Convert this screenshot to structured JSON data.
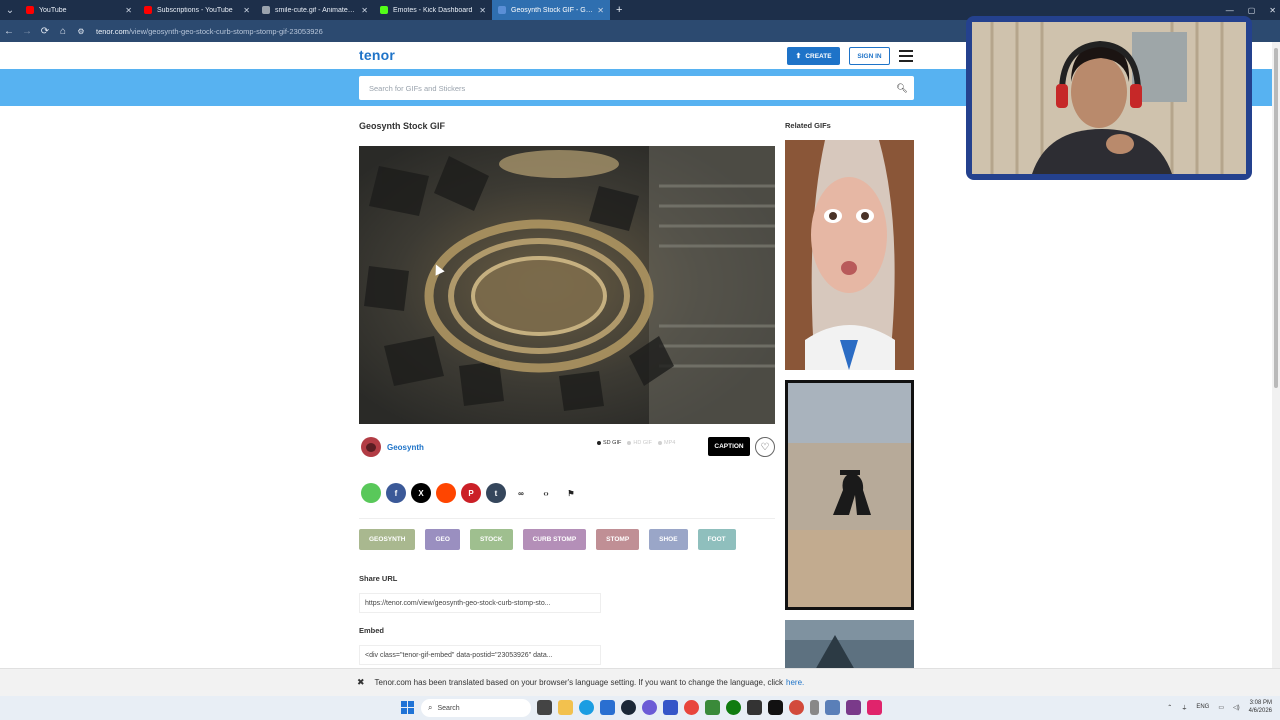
{
  "browser": {
    "tabs": [
      {
        "title": "YouTube",
        "favicon_color": "#ff0000",
        "active": false
      },
      {
        "title": "Subscriptions - YouTube",
        "favicon_color": "#ff0000",
        "active": false
      },
      {
        "title": "smile-cute.gif - Animated imag",
        "favicon_color": "#9aa3ad",
        "active": false
      },
      {
        "title": "Emotes - Kick Dashboard",
        "favicon_color": "#53fc18",
        "active": false
      },
      {
        "title": "Geosynth Stock GIF - Geosynth",
        "favicon_color": "#5a8fd6",
        "active": true
      }
    ],
    "url_host": "tenor.com",
    "url_path": "/view/geosynth-geo-stock-curb-stomp-stomp-gif-23053926"
  },
  "site": {
    "logo": "tenor",
    "create_label": "CREATE",
    "signin_label": "SIGN IN",
    "search_placeholder": "Search for GIFs and Stickers",
    "accent": "#1e73c8",
    "band_color": "#57b2f1"
  },
  "gif": {
    "title": "Geosynth Stock GIF",
    "author": "Geosynth",
    "formats": [
      {
        "label": "SD GIF",
        "selected": true
      },
      {
        "label": "HD GIF",
        "selected": false
      },
      {
        "label": "MP4",
        "selected": false
      }
    ],
    "caption_label": "CAPTION"
  },
  "share_icons": [
    {
      "name": "message-icon",
      "glyph": "",
      "color": "#59c85a"
    },
    {
      "name": "facebook-icon",
      "glyph": "f",
      "color": "#3b5998"
    },
    {
      "name": "x-icon",
      "glyph": "X",
      "color": "#000000"
    },
    {
      "name": "reddit-icon",
      "glyph": "",
      "color": "#ff4500"
    },
    {
      "name": "pinterest-icon",
      "glyph": "P",
      "color": "#cb2027"
    },
    {
      "name": "tumblr-icon",
      "glyph": "t",
      "color": "#35465c"
    },
    {
      "name": "link-icon",
      "glyph": "∞",
      "color": "#ffffff"
    },
    {
      "name": "embed-icon",
      "glyph": "‹›",
      "color": "#ffffff"
    },
    {
      "name": "flag-icon",
      "glyph": "⚑",
      "color": "#ffffff"
    }
  ],
  "tags": [
    {
      "label": "GEOSYNTH",
      "color": "#a9b88f"
    },
    {
      "label": "GEO",
      "color": "#9a8fc0"
    },
    {
      "label": "STOCK",
      "color": "#9fbf8f"
    },
    {
      "label": "CURB STOMP",
      "color": "#b48fb8"
    },
    {
      "label": "STOMP",
      "color": "#c08f95"
    },
    {
      "label": "SHOE",
      "color": "#9aa6c8"
    },
    {
      "label": "FOOT",
      "color": "#8fbfbd"
    }
  ],
  "share_url": {
    "label": "Share URL",
    "value": "https://tenor.com/view/geosynth-geo-stock-curb-stomp-sto..."
  },
  "embed": {
    "label": "Embed",
    "value": "<div class=\"tenor-gif-embed\" data-postid=\"23053926\" data..."
  },
  "related": {
    "heading": "Related GIFs"
  },
  "translation_bar": {
    "message": "Tenor.com has been translated based on your browser's language setting. If you want to change the language, click",
    "link": "here."
  },
  "taskbar": {
    "search_label": "Search",
    "lang": "ENG",
    "time": "3:08 PM",
    "date": "4/6/2026"
  }
}
